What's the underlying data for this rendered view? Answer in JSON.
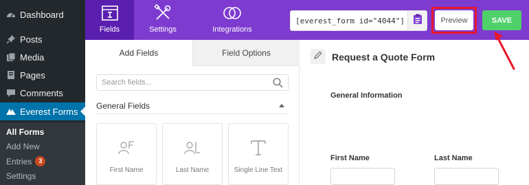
{
  "wp_menu": {
    "items": [
      {
        "label": "Dashboard",
        "icon": "dashboard-icon"
      },
      {
        "label": "Posts",
        "icon": "pushpin-icon"
      },
      {
        "label": "Media",
        "icon": "media-icon"
      },
      {
        "label": "Pages",
        "icon": "pages-icon"
      },
      {
        "label": "Comments",
        "icon": "comment-icon"
      },
      {
        "label": "Everest Forms",
        "icon": "everest-forms-icon"
      }
    ],
    "submenu": [
      {
        "label": "All Forms"
      },
      {
        "label": "Add New"
      },
      {
        "label": "Entries",
        "badge": "3"
      },
      {
        "label": "Settings"
      }
    ]
  },
  "builder_tabs": [
    {
      "label": "Fields",
      "icon": "fields-icon"
    },
    {
      "label": "Settings",
      "icon": "wrench-screwdriver-icon"
    },
    {
      "label": "Integrations",
      "icon": "integrations-icon"
    }
  ],
  "toolbar": {
    "shortcode": "[everest_form id=\"4044\"]",
    "preview_label": "Preview",
    "save_label": "SAVE"
  },
  "panel": {
    "tabs": [
      {
        "label": "Add Fields"
      },
      {
        "label": "Field Options"
      }
    ],
    "search_placeholder": "Search fields...",
    "section_title": "General Fields",
    "fields": [
      {
        "label": "First Name",
        "icon": "first-name-icon"
      },
      {
        "label": "Last Name",
        "icon": "last-name-icon"
      },
      {
        "label": "Single Line Text",
        "icon": "text-icon"
      }
    ]
  },
  "form": {
    "title": "Request a Quote Form",
    "section": "General Information",
    "field_labels": [
      "First Name",
      "Last Name"
    ]
  },
  "colors": {
    "topbar": "#7e3bd0",
    "active_tab": "#5b1fb0",
    "save": "#4ed16a",
    "highlight": "#e8172a",
    "wp_active": "#0073aa"
  }
}
